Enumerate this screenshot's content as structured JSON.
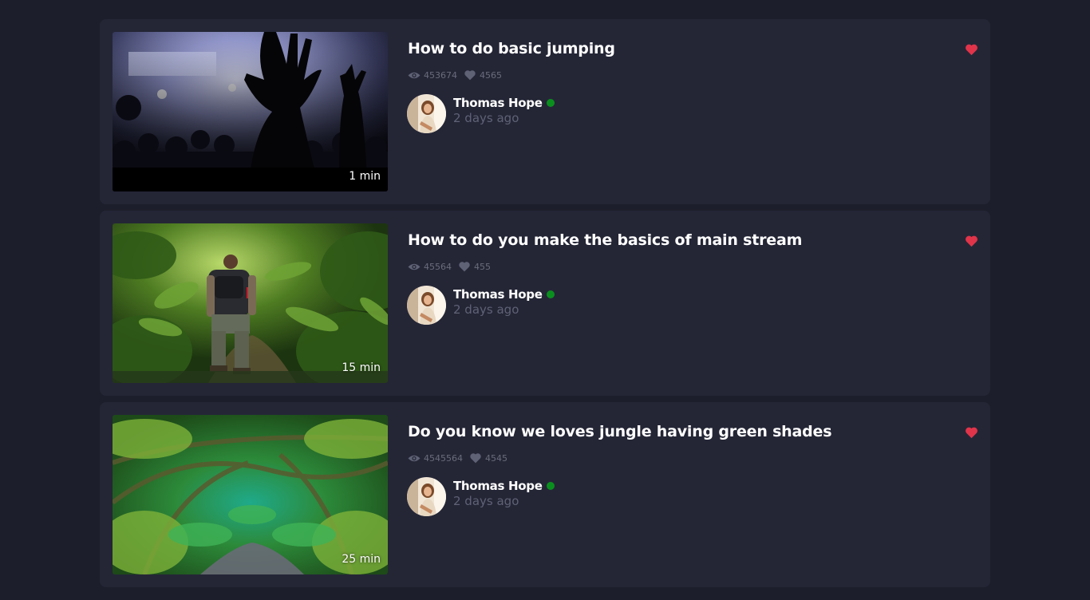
{
  "colors": {
    "page_background": "#1d1e2b",
    "card_background": "#242636",
    "heart_active": "#e0344a",
    "online": "#0a8f1e",
    "muted_text": "#6a6c7c"
  },
  "icons": {
    "views": "eye-icon",
    "likes": "heart-icon",
    "favorite": "heart-filled-icon",
    "status": "online-dot"
  },
  "videos": [
    {
      "title": "How to do basic jumping",
      "duration": "1 min",
      "views": "453674",
      "likes": "4565",
      "favorited": true,
      "author": {
        "name": "Thomas Hope",
        "online": true,
        "posted": "2 days ago"
      },
      "thumbnail": "concert-crowd-raised-hands"
    },
    {
      "title": "How to do you make the basics of main stream",
      "duration": "15 min",
      "views": "45564",
      "likes": "455",
      "favorited": true,
      "author": {
        "name": "Thomas Hope",
        "online": true,
        "posted": "2 days ago"
      },
      "thumbnail": "hiker-with-backpack-in-jungle"
    },
    {
      "title": "Do you know we loves jungle having green shades",
      "duration": "25 min",
      "views": "4545564",
      "likes": "4545",
      "favorited": true,
      "author": {
        "name": "Thomas Hope",
        "online": true,
        "posted": "2 days ago"
      },
      "thumbnail": "green-jungle-path-tunnel"
    }
  ]
}
